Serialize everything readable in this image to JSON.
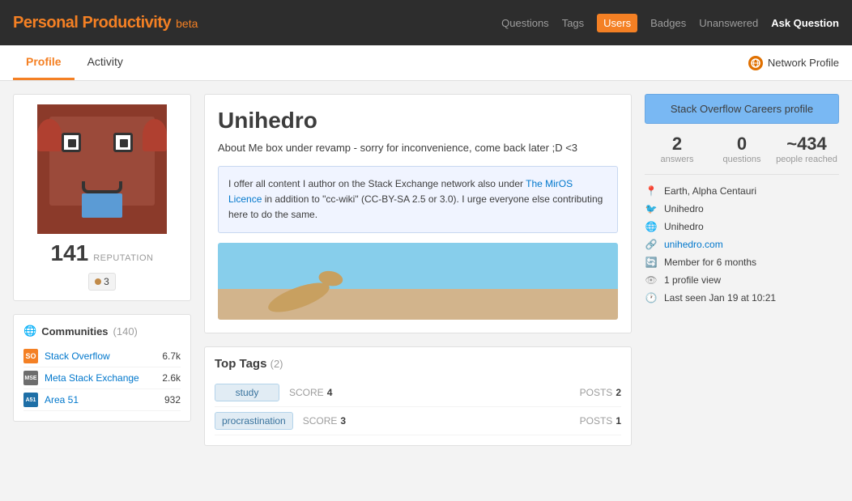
{
  "brand": {
    "main": "Personal Productivity",
    "beta": "beta"
  },
  "nav": {
    "items": [
      {
        "label": "Questions",
        "active": false
      },
      {
        "label": "Tags",
        "active": false
      },
      {
        "label": "Users",
        "active": true
      },
      {
        "label": "Badges",
        "active": false
      },
      {
        "label": "Unanswered",
        "active": false
      },
      {
        "label": "Ask Question",
        "special": true
      }
    ]
  },
  "subnav": {
    "tabs": [
      {
        "label": "Profile",
        "active": true
      },
      {
        "label": "Activity",
        "active": false
      }
    ],
    "network_profile": "Network Profile"
  },
  "user": {
    "name": "Unihedro",
    "reputation": "141",
    "reputation_label": "REPUTATION",
    "about_note": "About Me box under revamp - sorry for inconvenience, come back later ;D <3",
    "about_box": "I offer all content I author on the Stack Exchange network also under The MirOS Licence in addition to \"cc-wiki\" (CC-BY-SA 2.5 or 3.0). I urge everyone else contributing here to do the same.",
    "about_link_text": "The MirOS Licence",
    "badges": [
      {
        "color": "bronze",
        "count": "3"
      }
    ],
    "stats": {
      "answers": "2",
      "answers_label": "answers",
      "questions": "0",
      "questions_label": "questions",
      "people_reached": "~434",
      "people_reached_label": "people reached"
    },
    "meta": [
      {
        "icon": "location",
        "text": "Earth, Alpha Centauri"
      },
      {
        "icon": "twitter",
        "text": "Unihedro"
      },
      {
        "icon": "globe",
        "text": "Unihedro"
      },
      {
        "icon": "link",
        "text": "unihedro.com",
        "is_link": true
      },
      {
        "icon": "member",
        "text": "Member for 6 months"
      },
      {
        "icon": "view",
        "text": "1 profile view"
      },
      {
        "icon": "clock",
        "text": "Last seen Jan 19 at 10:21"
      }
    ]
  },
  "communities": {
    "title": "Communities",
    "count": "(140)",
    "items": [
      {
        "name": "Stack Overflow",
        "rep": "6.7k",
        "icon": "SO"
      },
      {
        "name": "Meta Stack Exchange",
        "rep": "2.6k",
        "icon": "MSE"
      },
      {
        "name": "Area 51",
        "rep": "932",
        "icon": "A51"
      }
    ]
  },
  "careers": {
    "button_label": "Stack Overflow Careers profile"
  },
  "top_tags": {
    "title": "Top Tags",
    "count": "(2)",
    "tags": [
      {
        "name": "study",
        "score_label": "SCORE",
        "score": "4",
        "posts_label": "POSTS",
        "posts": "2"
      },
      {
        "name": "procrastination",
        "score_label": "SCORE",
        "score": "3",
        "posts_label": "POSTS",
        "posts": "1"
      }
    ]
  }
}
